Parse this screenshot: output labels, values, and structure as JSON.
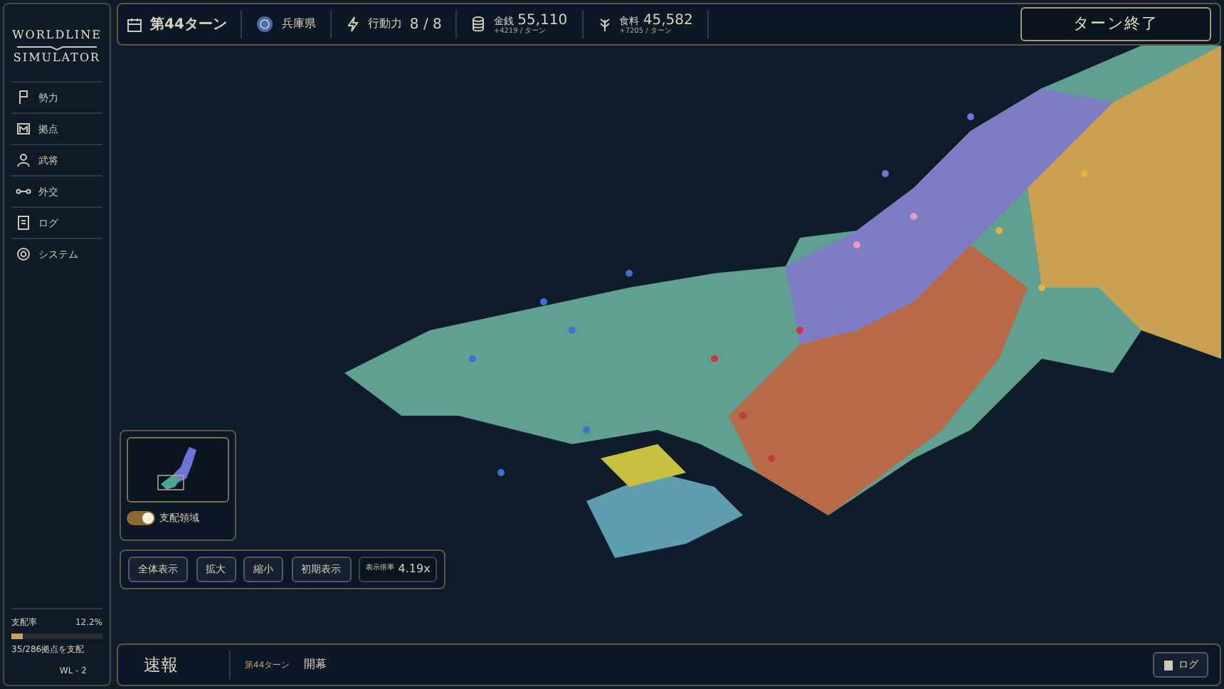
{
  "sidebar": {
    "logo": [
      "WORLDLINE",
      "SIMULATOR"
    ],
    "items": [
      {
        "label": "勢力"
      },
      {
        "label": "拠点"
      },
      {
        "label": "武将"
      },
      {
        "label": "外交"
      },
      {
        "label": "ログ"
      },
      {
        "label": "システム"
      }
    ],
    "control_rate": {
      "label": "支配率",
      "value": "12.2%",
      "level": 0.122,
      "caption": "35/286拠点を支配"
    },
    "version": "WL - 2"
  },
  "top_bar": {
    "turn": "第44ターン",
    "province": "兵庫県",
    "action": {
      "label": "行動力",
      "value": "8 / 8"
    },
    "resources": [
      {
        "kind": "money",
        "label": "金銭",
        "value": "55,110",
        "delta": "+4219 / ターン"
      },
      {
        "kind": "food",
        "label": "食料",
        "value": "45,582",
        "delta": "+7205 / ターン"
      }
    ],
    "end_turn": "ターン終了"
  },
  "minimap": {
    "toggle": {
      "label": "支配領域",
      "on": true
    }
  },
  "zoom_controls": {
    "buttons": [
      "全体表示",
      "拡大",
      "縮小",
      "初期表示"
    ],
    "scale": {
      "label": "表示倍率",
      "value": "4.19x"
    }
  },
  "news": {
    "title": "速報",
    "turn": "第44ターン",
    "message": "開幕",
    "log_button": "ログ"
  }
}
